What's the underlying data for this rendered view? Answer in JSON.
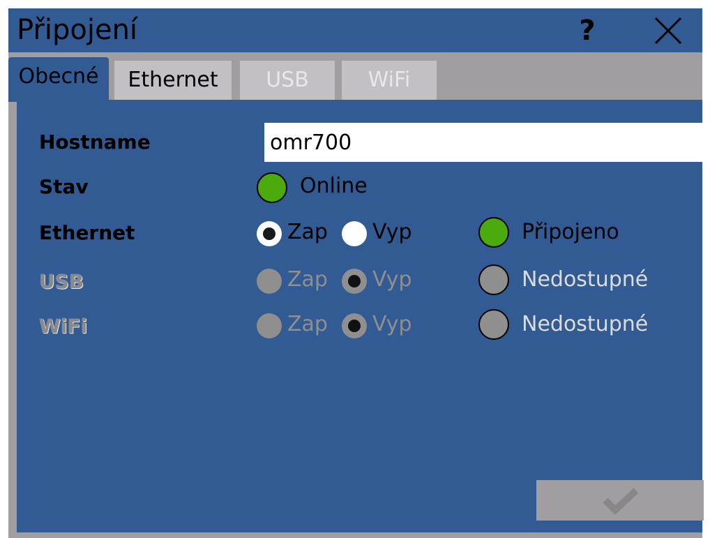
{
  "window": {
    "title": "Připojení",
    "help_label": "?",
    "close_icon": "close-icon"
  },
  "tabs": [
    {
      "label": "Obecné",
      "active": true,
      "enabled": true
    },
    {
      "label": "Ethernet",
      "active": false,
      "enabled": true
    },
    {
      "label": "USB",
      "active": false,
      "enabled": false
    },
    {
      "label": "WiFi",
      "active": false,
      "enabled": false
    }
  ],
  "general": {
    "hostname_label": "Hostname",
    "hostname_value": "omr700",
    "status_label": "Stav",
    "status_text": "Online",
    "status_color": "#4aaa0e",
    "rows": [
      {
        "label": "Ethernet",
        "enabled": true,
        "on_label": "Zap",
        "off_label": "Vyp",
        "selected": "Zap",
        "state_text": "Připojeno",
        "state_color": "#4aaa0e"
      },
      {
        "label": "USB",
        "enabled": false,
        "on_label": "Zap",
        "off_label": "Vyp",
        "selected": "Vyp",
        "state_text": "Nedostupné",
        "state_color": "#8f8f8f"
      },
      {
        "label": "WiFi",
        "enabled": false,
        "on_label": "Zap",
        "off_label": "Vyp",
        "selected": "Vyp",
        "state_text": "Nedostupné",
        "state_color": "#8f8f8f"
      }
    ]
  },
  "actions": {
    "ok_icon": "checkmark-icon",
    "ok_enabled": false
  },
  "colors": {
    "panel": "#325b93",
    "frame": "#a09ea0",
    "tab_inactive": "#c2c0c2"
  }
}
